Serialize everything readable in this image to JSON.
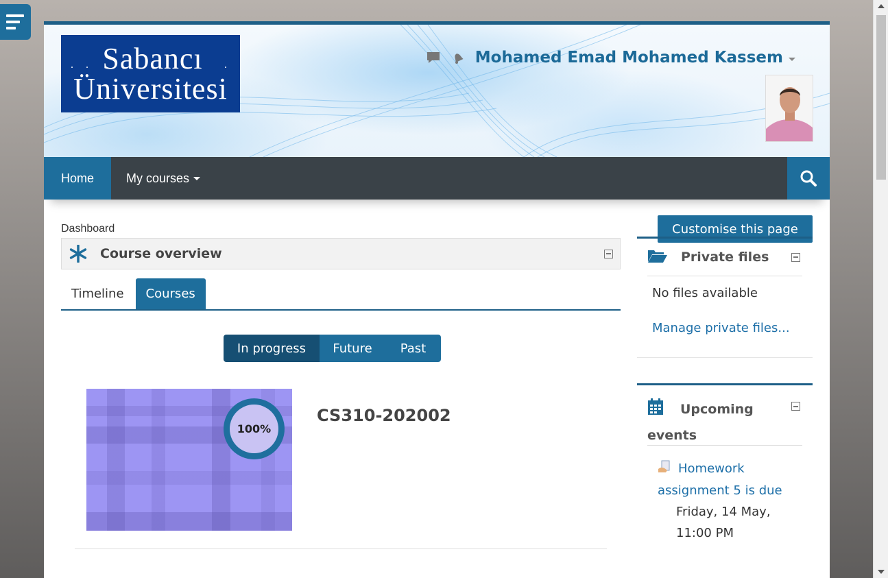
{
  "logo": {
    "line1": "Sabancı",
    "line2": "Üniversitesi"
  },
  "header": {
    "username": "Mohamed Emad Mohamed Kassem",
    "icons": [
      "message-icon",
      "bell-icon"
    ]
  },
  "nav": {
    "home": "Home",
    "my_courses": "My courses",
    "search_icon": "search-icon"
  },
  "breadcrumb": "Dashboard",
  "customise_button": "Customise this page",
  "course_overview": {
    "title": "Course overview",
    "tabs": [
      "Timeline",
      "Courses"
    ],
    "active_tab": "Courses",
    "filters": [
      "In progress",
      "Future",
      "Past"
    ],
    "active_filter": "In progress",
    "course": {
      "name": "CS310-202002",
      "progress_label": "100%",
      "progress": 100
    }
  },
  "private_files": {
    "title": "Private files",
    "empty": "No files available",
    "manage_link": "Manage private files..."
  },
  "upcoming_events": {
    "title_line1": "Upcoming",
    "title_line2": "events",
    "events": [
      {
        "line1": "Homework",
        "line2": "assignment 5 is due",
        "date": "Friday, 14 May,",
        "time": "11:00 PM"
      }
    ]
  },
  "colors": {
    "accent": "#1e6e9c",
    "navbar": "#3a4248",
    "link": "#1d6fa8"
  }
}
